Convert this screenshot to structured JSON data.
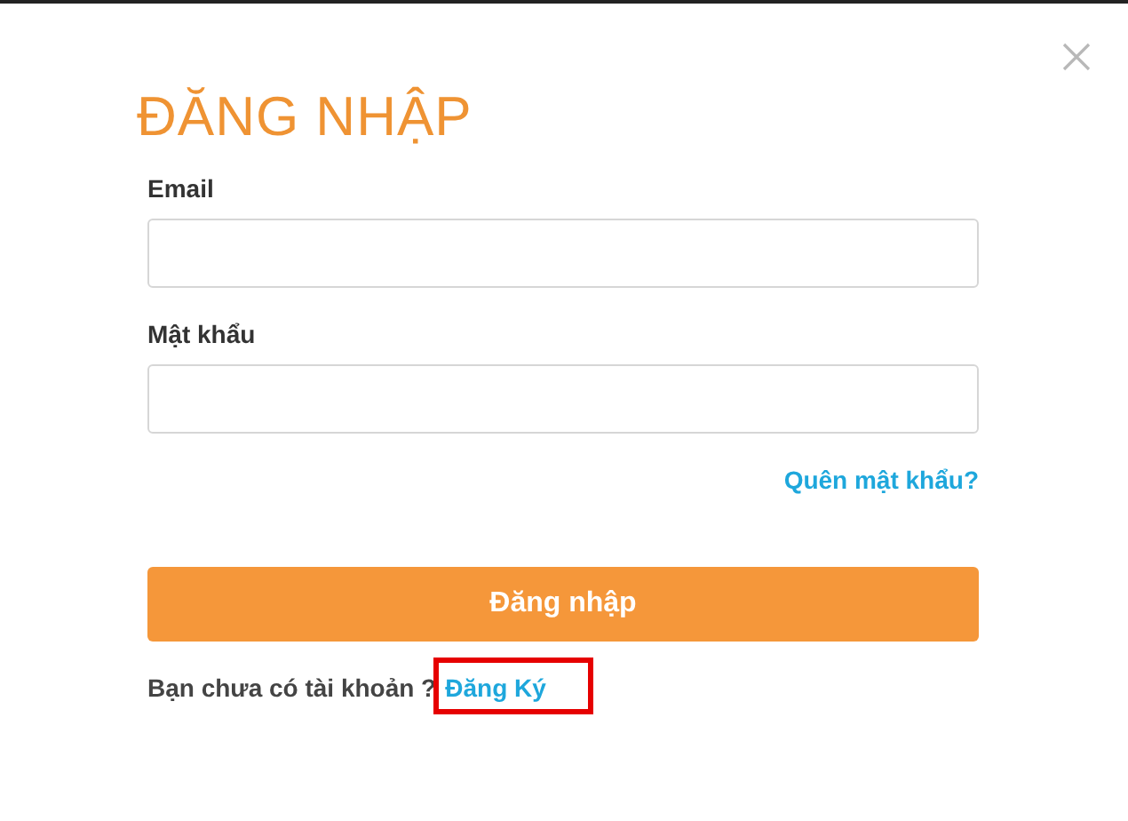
{
  "dialog": {
    "title": "ĐĂNG NHẬP",
    "fields": [
      {
        "label": "Email"
      },
      {
        "label": "Mật khẩu"
      }
    ],
    "forgot_link": "Quên mật khẩu?",
    "submit_button": "Đăng nhập",
    "signup_prompt": "Bạn chưa có tài khoản ?",
    "signup_link": {
      "label": "Đăng Ký",
      "highlighted": true
    }
  }
}
